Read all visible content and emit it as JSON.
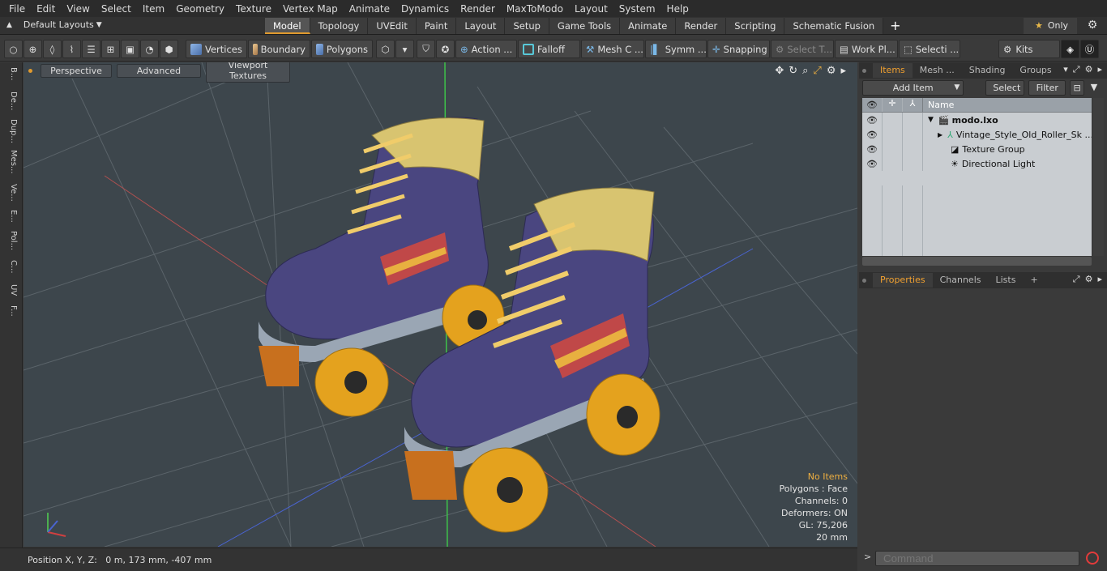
{
  "menu": [
    "File",
    "Edit",
    "View",
    "Select",
    "Item",
    "Geometry",
    "Texture",
    "Vertex Map",
    "Animate",
    "Dynamics",
    "Render",
    "MaxToModo",
    "Layout",
    "System",
    "Help"
  ],
  "layouts_label": "Default Layouts",
  "tabs": [
    "Model",
    "Topology",
    "UVEdit",
    "Paint",
    "Layout",
    "Setup",
    "Game Tools",
    "Animate",
    "Render",
    "Scripting",
    "Schematic Fusion"
  ],
  "only_label": "Only",
  "toolbar": {
    "vertices": "Vertices",
    "boundary": "Boundary",
    "polygons": "Polygons",
    "action": "Action ...",
    "falloff": "Falloff",
    "mesh": "Mesh C ...",
    "symm": "Symm ...",
    "snapping": "Snapping",
    "select_t": "Select T...",
    "workpl": "Work Pl...",
    "selecti": "Selecti ...",
    "kits": "Kits"
  },
  "left_tabs": [
    "B...",
    "De...",
    "Dup...",
    "Mes...",
    "Ve...",
    "E...",
    "Pol...",
    "C...",
    "UV",
    "F..."
  ],
  "viewport": {
    "perspective": "Perspective",
    "advanced": "Advanced",
    "textures": "Viewport Textures",
    "info": {
      "no_items": "No Items",
      "polygons": "Polygons : Face",
      "channels": "Channels: 0",
      "deformers": "Deformers: ON",
      "gl": "GL: 75,206",
      "scale": "20 mm"
    }
  },
  "status": "Position X, Y, Z:   0 m, 173 mm, -407 mm",
  "items_panel": {
    "tabs": [
      "Items",
      "Mesh ...",
      "Shading",
      "Groups"
    ],
    "add_item": "Add Item",
    "select": "Select",
    "filter": "Filter",
    "col_name": "Name",
    "rows": [
      "modo.lxo",
      "Vintage_Style_Old_Roller_Sk ...",
      "Texture Group",
      "Directional Light"
    ]
  },
  "props_panel": {
    "tabs": [
      "Properties",
      "Channels",
      "Lists"
    ]
  },
  "command_placeholder": "Command"
}
